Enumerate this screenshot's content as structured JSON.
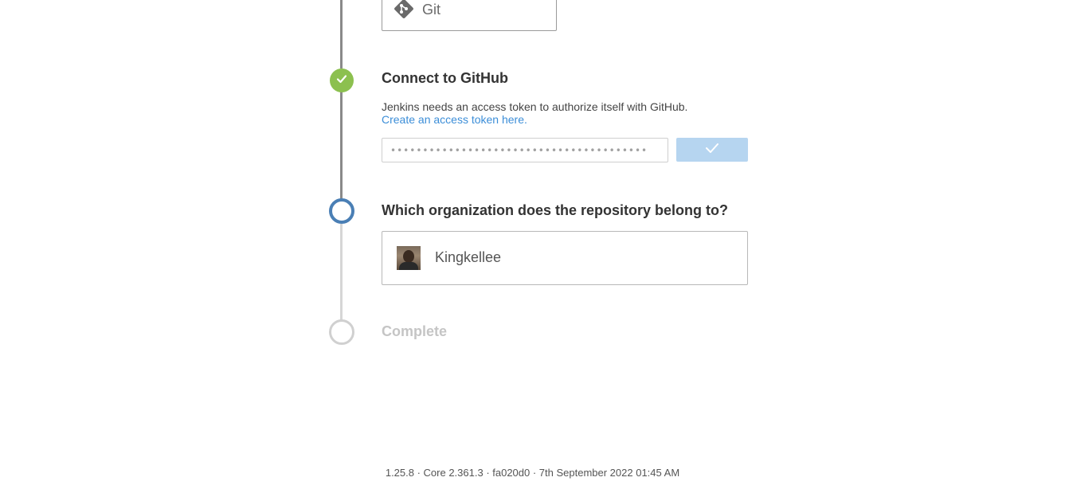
{
  "scm_option": {
    "label": "Git",
    "icon": "git-icon"
  },
  "steps": {
    "connect": {
      "title": "Connect to GitHub",
      "description": "Jenkins needs an access token to authorize itself with GitHub.",
      "link_text": "Create an access token here.",
      "token_value": "••••••••••••••••••••••••••••••••••••••••",
      "status": "complete"
    },
    "organization": {
      "title": "Which organization does the repository belong to?",
      "status": "active",
      "options": [
        {
          "name": "Kingkellee"
        }
      ]
    },
    "complete": {
      "title": "Complete",
      "status": "pending"
    }
  },
  "colors": {
    "done": "#8cc04f",
    "active": "#4a7fb5",
    "pending": "#d0d0d0",
    "link": "#3c8ed8",
    "button": "#b6d5f0"
  },
  "footer": {
    "version_text": "1.25.8 · Core 2.361.3 · fa020d0 · 7th September 2022 01:45 AM"
  }
}
